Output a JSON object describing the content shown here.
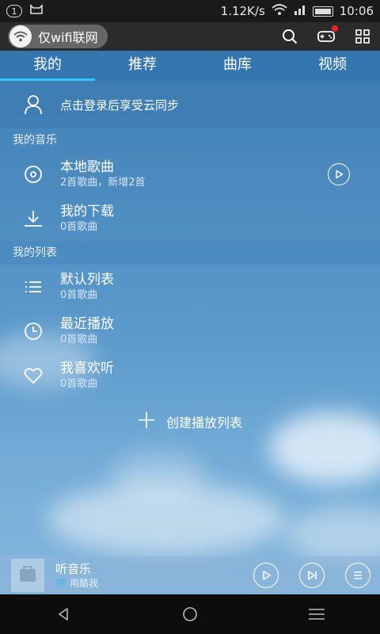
{
  "status_bar": {
    "notification_badge": "1",
    "network_speed": "1.12K/s",
    "time": "10:06"
  },
  "header": {
    "wifi_label": "仅wifi联网",
    "icons": [
      "search-icon",
      "gamepad-icon",
      "grid-icon"
    ]
  },
  "tabs": [
    {
      "label": "我的",
      "active": true
    },
    {
      "label": "推荐",
      "active": false
    },
    {
      "label": "曲库",
      "active": false
    },
    {
      "label": "视频",
      "active": false
    }
  ],
  "login": {
    "text": "点击登录后享受云同步"
  },
  "my_music": {
    "section_title": "我的音乐",
    "items": [
      {
        "title": "本地歌曲",
        "subtitle": "2首歌曲，新增2首",
        "icon": "disc-icon"
      },
      {
        "title": "我的下载",
        "subtitle": "0首歌曲",
        "icon": "download-icon"
      }
    ]
  },
  "my_lists": {
    "section_title": "我的列表",
    "items": [
      {
        "title": "默认列表",
        "subtitle": "0首歌曲",
        "icon": "list-icon"
      },
      {
        "title": "最近播放",
        "subtitle": "0首歌曲",
        "icon": "clock-icon"
      },
      {
        "title": "我喜欢听",
        "subtitle": "0首歌曲",
        "icon": "heart-icon"
      }
    ],
    "create_label": "创建播放列表"
  },
  "player": {
    "title": "听音乐",
    "subtitle": "用酷我"
  },
  "colors": {
    "accent": "#2fc8ff",
    "notification_dot": "#f02020"
  }
}
